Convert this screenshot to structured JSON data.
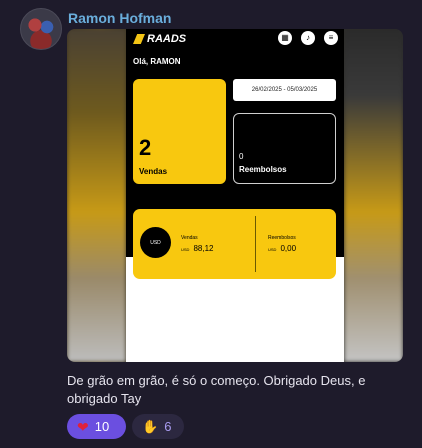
{
  "message": {
    "author": "Ramon Hofman",
    "text": "De grão em grão, é só o começo. Obrigado Deus, e obrigado Tay"
  },
  "app": {
    "brand": "RAADS",
    "greeting": "Olá, RAMON",
    "date_range": "26/02/2025 - 05/03/2025",
    "sales": {
      "count": "2",
      "label": "Vendas"
    },
    "refunds": {
      "count": "0",
      "label": "Reembolsos"
    },
    "usd_card": {
      "badge": "USD",
      "sales_title": "Vendas",
      "sales_currency": "USD",
      "sales_value": "88,12",
      "refunds_title": "Reembolsos",
      "refunds_currency": "USD",
      "refunds_value": "0,00"
    },
    "header_icons": [
      "calendar-icon",
      "bell-icon",
      "menu-icon"
    ]
  },
  "reactions": [
    {
      "icon": "heart-icon",
      "count": "10"
    },
    {
      "icon": "clapping-hands-icon",
      "count": "6"
    }
  ],
  "colors": {
    "accent": "#f8c80f",
    "reaction_active": "#6b4fe0",
    "author": "#6aaedc"
  }
}
